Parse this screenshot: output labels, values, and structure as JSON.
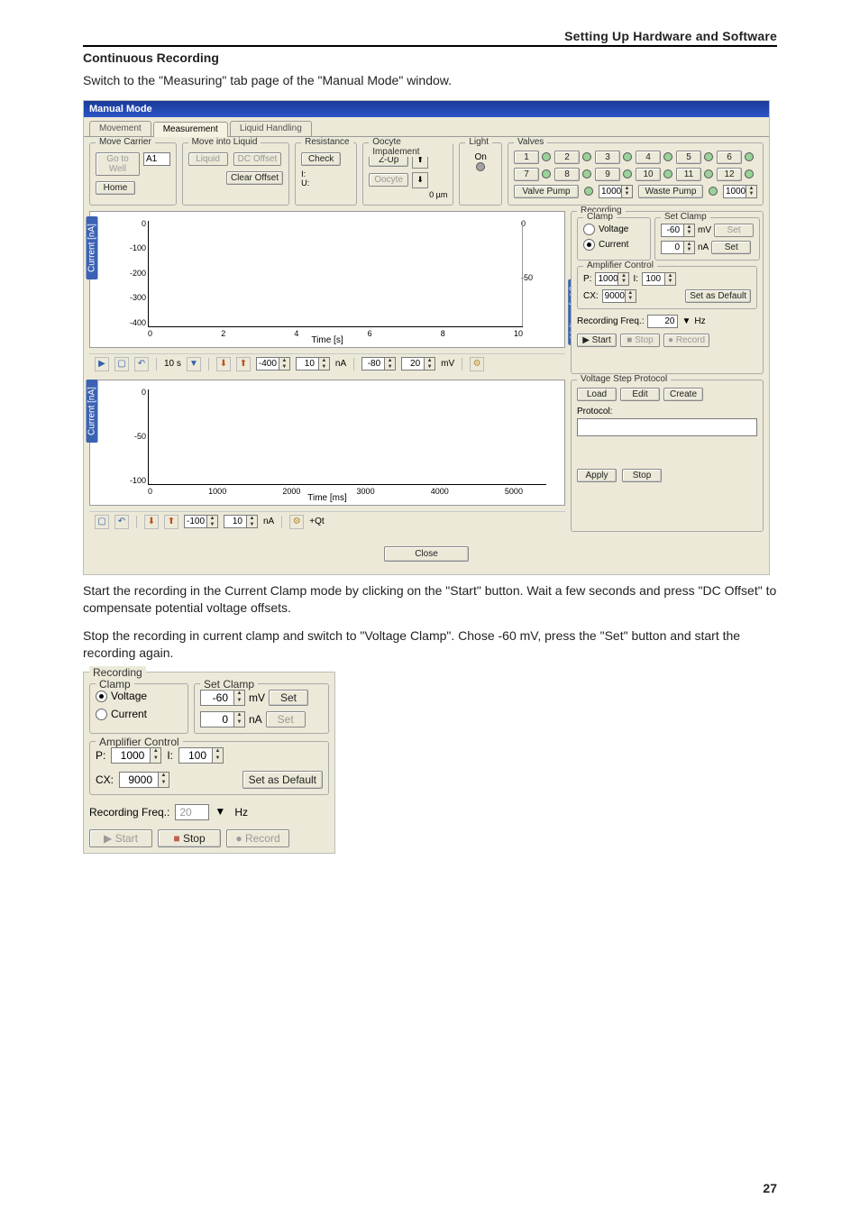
{
  "doc": {
    "chapter": "Setting Up Hardware and Software",
    "heading": "Continuous Recording",
    "para1": "Switch to the \"Measuring\" tab page of the \"Manual Mode\" window.",
    "para2": "Start the recording in the Current Clamp mode by clicking on the \"Start\" button. Wait a few seconds and press \"DC Offset\" to compensate potential voltage offsets.",
    "para3": "Stop the recording in current clamp and switch to \"Voltage Clamp\". Chose -60 mV, press the \"Set\" button and start the recording again.",
    "page_number": "27"
  },
  "win": {
    "title": "Manual Mode",
    "tabs": {
      "movement": "Movement",
      "measurement": "Measurement",
      "liquid": "Liquid Handling"
    },
    "move_carrier": {
      "legend": "Move Carrier",
      "goto": "Go to Well",
      "well": "A1",
      "home": "Home"
    },
    "move_liquid": {
      "legend": "Move into Liquid",
      "liquid": "Liquid",
      "dcoffset": "DC Offset",
      "clear": "Clear Offset"
    },
    "resistance": {
      "legend": "Resistance",
      "check": "Check",
      "I": "I:",
      "U": "U:"
    },
    "oocyte": {
      "legend": "Oocyte Impalement",
      "zup": "Z-Up",
      "oocyte": "Oocyte",
      "um": "0 µm"
    },
    "light": {
      "legend": "Light",
      "on": "On"
    },
    "valves": {
      "legend": "Valves",
      "names": [
        "1",
        "2",
        "3",
        "4",
        "5",
        "6",
        "7",
        "8",
        "9",
        "10",
        "11",
        "12"
      ],
      "valvePump": "Valve Pump",
      "vp_val": "1000",
      "wastePump": "Waste Pump",
      "wp_val": "1000"
    },
    "recording": {
      "legend": "Recording",
      "clamp": {
        "legend": "Clamp",
        "voltage": "Voltage",
        "current": "Current"
      },
      "setclamp": {
        "legend": "Set Clamp",
        "vval": "-60",
        "v_unit": "mV",
        "set1": "Set",
        "ival": "0",
        "i_unit": "nA",
        "set2": "Set"
      },
      "ampctrl": {
        "legend": "Amplifier Control",
        "P": "P:",
        "Pval": "1000",
        "I": "I:",
        "Ival": "100",
        "CX": "CX:",
        "CXval": "9000",
        "setdef": "Set as Default"
      },
      "freq_label": "Recording Freq.:",
      "freq_val": "20",
      "freq_unit": "Hz",
      "start": "Start",
      "stop": "Stop",
      "record": "Record"
    },
    "vsp": {
      "legend": "Voltage Step Protocol",
      "load": "Load",
      "edit": "Edit",
      "create": "Create",
      "protLabel": "Protocol:",
      "apply": "Apply",
      "stop": "Stop"
    },
    "close": "Close",
    "chart1": {
      "yl_label": "Current [nA]",
      "yr_label": "Voltage [mV]",
      "xlabel": "Time [s]",
      "yticks": [
        "0",
        "-100",
        "-200",
        "-300",
        "-400"
      ],
      "yr_ticks": [
        "0",
        "-50"
      ],
      "xticks": [
        "0",
        "2",
        "4",
        "6",
        "8",
        "10"
      ],
      "tb": {
        "time": "10 s",
        "neg400": "-400",
        "v10": "10",
        "unit_nA": "nA",
        "neg80": "-80",
        "v20": "20",
        "unit_mV": "mV"
      }
    },
    "chart2": {
      "yl_label": "Current [nA]",
      "xlabel": "Time [ms]",
      "yticks": [
        "0",
        "-50",
        "-100"
      ],
      "xticks": [
        "0",
        "1000",
        "2000",
        "3000",
        "4000",
        "5000"
      ],
      "tb": {
        "neg100": "-100",
        "v10": "10",
        "unit_nA": "nA",
        "qlabel": "+Qt"
      }
    }
  },
  "detail": {
    "recording": "Recording",
    "clamp": {
      "legend": "Clamp",
      "voltage": "Voltage",
      "current": "Current"
    },
    "setclamp": {
      "legend": "Set Clamp",
      "vval": "-60",
      "v_unit": "mV",
      "set1": "Set",
      "ival": "0",
      "i_unit": "nA",
      "set2": "Set"
    },
    "amp": {
      "legend": "Amplifier Control",
      "P": "P:",
      "Pval": "1000",
      "I": "I:",
      "Ival": "100",
      "CX": "CX:",
      "CXval": "9000",
      "setdef": "Set as Default"
    },
    "freq_label": "Recording Freq.:",
    "freq_val": "20",
    "freq_unit": "Hz",
    "start": "Start",
    "stop": "Stop",
    "record": "Record"
  },
  "chart_data": [
    {
      "type": "line",
      "title": "",
      "categories": [
        0,
        2,
        4,
        6,
        8,
        10
      ],
      "series": [
        {
          "name": "Current [nA]",
          "values": [
            null,
            null,
            null,
            null,
            null,
            null
          ]
        },
        {
          "name": "Voltage [mV]",
          "values": [
            null,
            null,
            null,
            null,
            null,
            null
          ]
        }
      ],
      "xlabel": "Time [s]",
      "ylabel": "Current [nA]",
      "y2label": "Voltage [mV]",
      "ylim": [
        -400,
        0
      ],
      "y2lim": [
        -50,
        0
      ]
    },
    {
      "type": "line",
      "title": "",
      "categories": [
        0,
        1000,
        2000,
        3000,
        4000,
        5000
      ],
      "series": [
        {
          "name": "Current [nA]",
          "values": [
            null,
            null,
            null,
            null,
            null,
            null
          ]
        }
      ],
      "xlabel": "Time [ms]",
      "ylabel": "Current [nA]",
      "ylim": [
        -100,
        0
      ]
    }
  ]
}
